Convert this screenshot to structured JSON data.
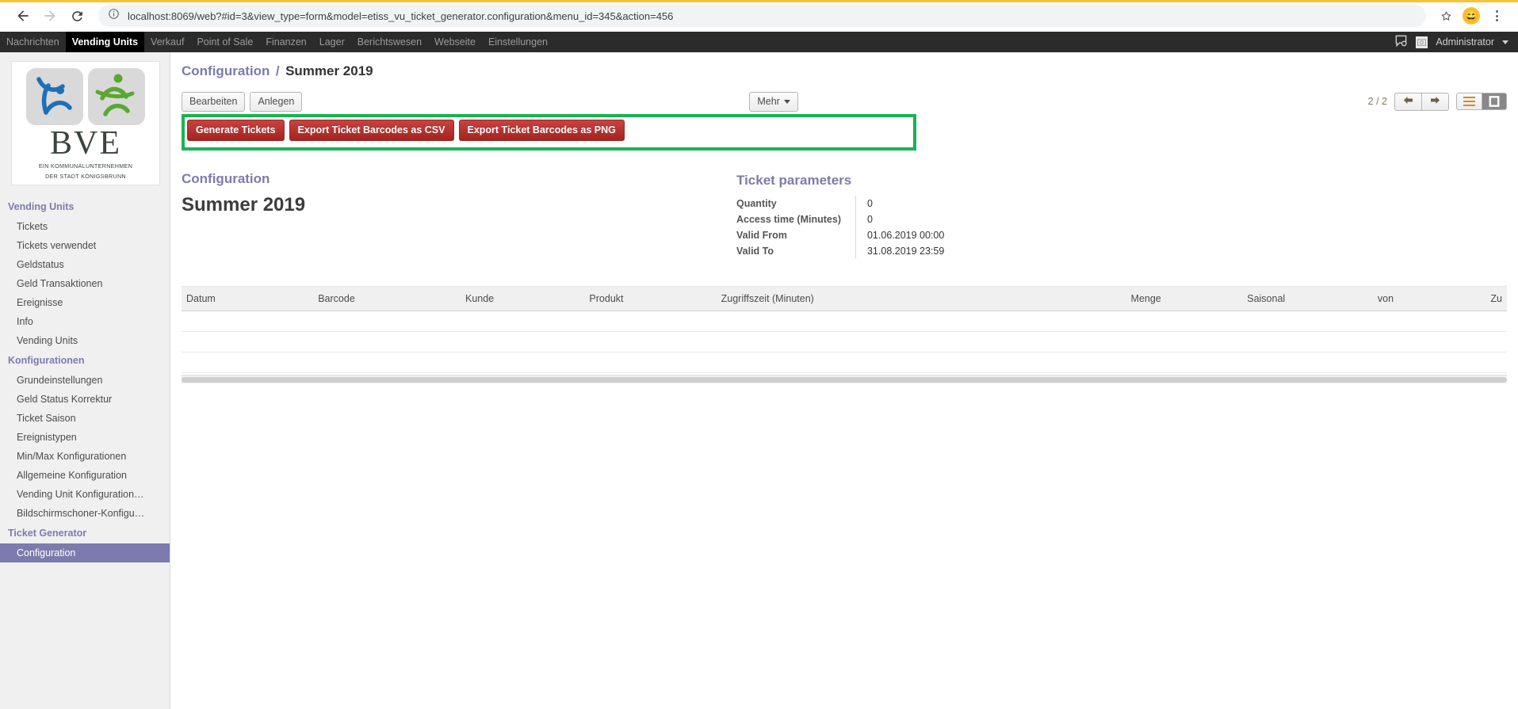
{
  "browser": {
    "url": "localhost:8069/web?#id=3&view_type=form&model=etiss_vu_ticket_generator.configuration&menu_id=345&action=456",
    "back_icon": "back-arrow-icon",
    "forward_icon": "forward-arrow-icon",
    "reload_icon": "reload-icon",
    "info_icon": "info-circle-icon",
    "star_icon": "star-icon",
    "profile_icon": "emoji-avatar-icon",
    "menu_icon": "kebab-menu-icon"
  },
  "topbar": {
    "menus": [
      {
        "label": "Nachrichten",
        "active": false
      },
      {
        "label": "Vending Units",
        "active": true
      },
      {
        "label": "Verkauf",
        "active": false
      },
      {
        "label": "Point of Sale",
        "active": false
      },
      {
        "label": "Finanzen",
        "active": false
      },
      {
        "label": "Lager",
        "active": false
      },
      {
        "label": "Berichtswesen",
        "active": false
      },
      {
        "label": "Webseite",
        "active": false
      },
      {
        "label": "Einstellungen",
        "active": false
      }
    ],
    "chat_icon": "chat-bubble-icon",
    "user_name": "Administrator"
  },
  "sidebar": {
    "logo": {
      "word": "BVE",
      "line1": "EIN KOMMUNALUNTERNEHMEN",
      "line2": "DER STADT KÖNIGSBRUNN"
    },
    "sections": [
      {
        "title": "Vending Units",
        "items": [
          {
            "label": "Tickets",
            "selected": false
          },
          {
            "label": "Tickets verwendet",
            "selected": false
          },
          {
            "label": "Geldstatus",
            "selected": false
          },
          {
            "label": "Geld Transaktionen",
            "selected": false
          },
          {
            "label": "Ereignisse",
            "selected": false
          },
          {
            "label": "Info",
            "selected": false
          },
          {
            "label": "Vending Units",
            "selected": false
          }
        ]
      },
      {
        "title": "Konfigurationen",
        "items": [
          {
            "label": "Grundeinstellungen",
            "selected": false
          },
          {
            "label": "Geld Status Korrektur",
            "selected": false
          },
          {
            "label": "Ticket Saison",
            "selected": false
          },
          {
            "label": "Ereignistypen",
            "selected": false
          },
          {
            "label": "Min/Max Konfigurationen",
            "selected": false
          },
          {
            "label": "Allgemeine Konfiguration",
            "selected": false
          },
          {
            "label": "Vending Unit Konfiguration…",
            "selected": false
          },
          {
            "label": "Bildschirmschoner-Konfigu…",
            "selected": false
          }
        ]
      },
      {
        "title": "Ticket Generator",
        "items": [
          {
            "label": "Configuration",
            "selected": true
          }
        ]
      }
    ]
  },
  "breadcrumb": {
    "root": "Configuration",
    "separator": "/",
    "leaf": "Summer 2019"
  },
  "controls": {
    "edit_label": "Bearbeiten",
    "create_label": "Anlegen",
    "more_label": "Mehr",
    "pager": "2 / 2",
    "prev_icon": "arrow-left-icon",
    "next_icon": "arrow-right-icon",
    "list_view_icon": "list-view-icon",
    "form_view_icon": "form-view-icon"
  },
  "actions": {
    "generate_tickets": "Generate Tickets",
    "export_csv": "Export Ticket Barcodes as CSV",
    "export_png": "Export Ticket Barcodes as PNG",
    "highlight_color": "#19b352",
    "button_color": "#a32420"
  },
  "form": {
    "left_group_title": "Configuration",
    "record_name": "Summer 2019",
    "right_group_title": "Ticket parameters",
    "fields": [
      {
        "label": "Quantity",
        "value": "0"
      },
      {
        "label": "Access time (Minutes)",
        "value": "0"
      },
      {
        "label": "Valid From",
        "value": "01.06.2019 00:00"
      },
      {
        "label": "Valid To",
        "value": "31.08.2019 23:59"
      }
    ]
  },
  "lines_table": {
    "columns": [
      {
        "label": "Datum",
        "align": "left"
      },
      {
        "label": "Barcode",
        "align": "left"
      },
      {
        "label": "Kunde",
        "align": "left"
      },
      {
        "label": "Produkt",
        "align": "left"
      },
      {
        "label": "Zugriffszeit (Minuten)",
        "align": "left"
      },
      {
        "label": "Menge",
        "align": "right"
      },
      {
        "label": "Saisonal",
        "align": "right"
      },
      {
        "label": "von",
        "align": "right"
      },
      {
        "label": "Zu",
        "align": "right"
      }
    ],
    "rows": []
  }
}
